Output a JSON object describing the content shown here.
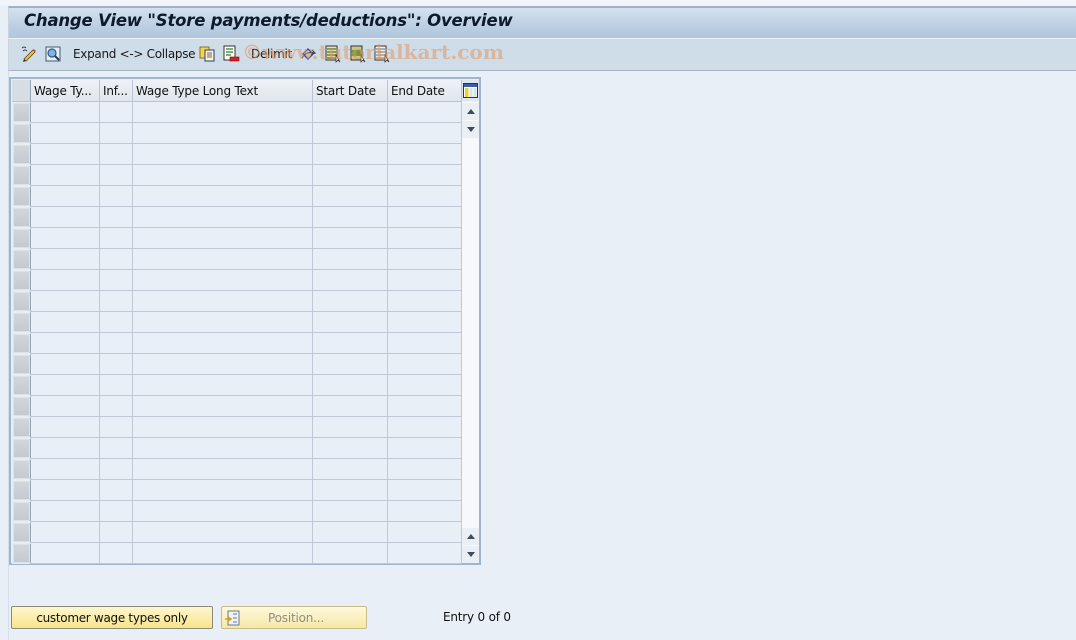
{
  "window": {
    "title": "Change View \"Store payments/deductions\": Overview"
  },
  "toolbar": {
    "items": [
      {
        "icon": "display-change-icon",
        "label": ""
      },
      {
        "icon": "find-icon",
        "label": ""
      },
      {
        "icon": "",
        "label": "Expand <-> Collapse"
      },
      {
        "icon": "copy-as-icon",
        "label": ""
      },
      {
        "icon": "delete-icon",
        "label": ""
      },
      {
        "icon": "",
        "label": "Delimit"
      },
      {
        "icon": "undo-change-icon",
        "label": ""
      },
      {
        "icon": "select-all-icon",
        "label": ""
      },
      {
        "icon": "select-block-icon",
        "label": ""
      },
      {
        "icon": "deselect-all-icon",
        "label": ""
      }
    ],
    "watermark": "©www.tutorialkart.com"
  },
  "table": {
    "columns": [
      "Wage Ty...",
      "Inf...",
      "Wage Type Long Text",
      "Start Date",
      "End Date"
    ],
    "rows": [
      [
        "",
        "",
        "",
        "",
        ""
      ],
      [
        "",
        "",
        "",
        "",
        ""
      ],
      [
        "",
        "",
        "",
        "",
        ""
      ],
      [
        "",
        "",
        "",
        "",
        ""
      ],
      [
        "",
        "",
        "",
        "",
        ""
      ],
      [
        "",
        "",
        "",
        "",
        ""
      ],
      [
        "",
        "",
        "",
        "",
        ""
      ],
      [
        "",
        "",
        "",
        "",
        ""
      ],
      [
        "",
        "",
        "",
        "",
        ""
      ],
      [
        "",
        "",
        "",
        "",
        ""
      ],
      [
        "",
        "",
        "",
        "",
        ""
      ],
      [
        "",
        "",
        "",
        "",
        ""
      ],
      [
        "",
        "",
        "",
        "",
        ""
      ],
      [
        "",
        "",
        "",
        "",
        ""
      ],
      [
        "",
        "",
        "",
        "",
        ""
      ],
      [
        "",
        "",
        "",
        "",
        ""
      ],
      [
        "",
        "",
        "",
        "",
        ""
      ],
      [
        "",
        "",
        "",
        "",
        ""
      ],
      [
        "",
        "",
        "",
        "",
        ""
      ],
      [
        "",
        "",
        "",
        "",
        ""
      ],
      [
        "",
        "",
        "",
        "",
        ""
      ],
      [
        "",
        "",
        "",
        "",
        ""
      ]
    ]
  },
  "footer": {
    "customer_button": "customer wage types only",
    "position_button": "Position...",
    "entry_status": "Entry 0 of 0"
  }
}
